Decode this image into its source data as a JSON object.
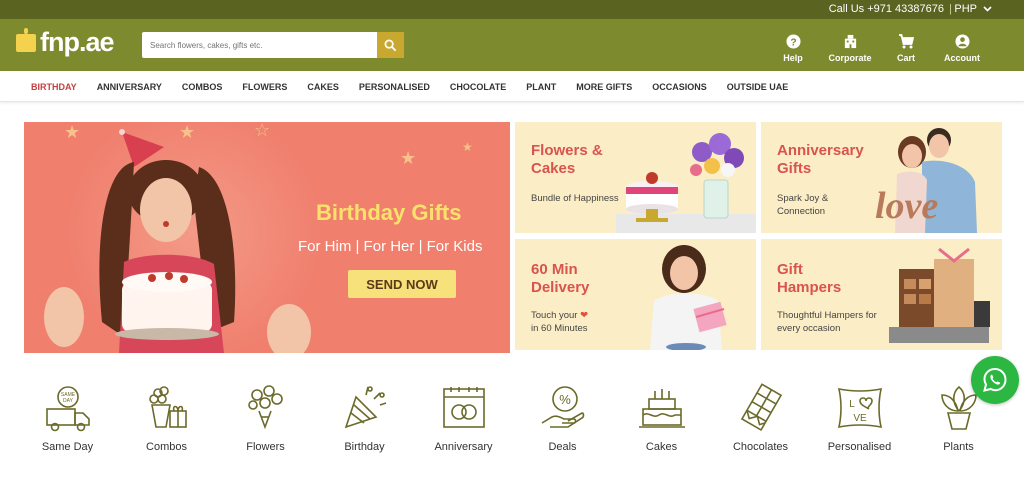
{
  "topbar": {
    "call": "Call Us +971 43387676",
    "separator": "|",
    "currency": "PHP"
  },
  "header": {
    "logo": "fnp.ae",
    "search_placeholder": "Search flowers, cakes, gifts etc.",
    "nav": [
      {
        "label": "Help",
        "icon": "help-icon"
      },
      {
        "label": "Corporate",
        "icon": "corporate-icon"
      },
      {
        "label": "Cart",
        "icon": "cart-icon"
      },
      {
        "label": "Account",
        "icon": "account-icon"
      }
    ]
  },
  "categories_nav": [
    "BIRTHDAY",
    "ANNIVERSARY",
    "COMBOS",
    "FLOWERS",
    "CAKES",
    "PERSONALISED",
    "CHOCOLATE",
    "PLANT",
    "MORE GIFTS",
    "OCCASIONS",
    "OUTSIDE UAE"
  ],
  "hero": {
    "title": "Birthday Gifts",
    "subtitle": "For Him | For Her | For Kids",
    "button": "SEND NOW"
  },
  "tiles": [
    {
      "title": "Flowers & Cakes",
      "subtitle": "Bundle of Happiness"
    },
    {
      "title": "Anniversary Gifts",
      "subtitle": "Spark Joy & Connection"
    },
    {
      "title": "60 Min Delivery",
      "subtitle_part1": "Touch your",
      "subtitle_part2": "in 60 Minutes"
    },
    {
      "title": "Gift Hampers",
      "subtitle": "Thoughtful Hampers for every occasion"
    }
  ],
  "bottom_categories": [
    {
      "label": "Same Day",
      "icon": "same-day-truck-icon"
    },
    {
      "label": "Combos",
      "icon": "combos-icon"
    },
    {
      "label": "Flowers",
      "icon": "flowers-icon"
    },
    {
      "label": "Birthday",
      "icon": "party-popper-icon"
    },
    {
      "label": "Anniversary",
      "icon": "rings-icon"
    },
    {
      "label": "Deals",
      "icon": "deals-icon"
    },
    {
      "label": "Cakes",
      "icon": "cake-icon"
    },
    {
      "label": "Chocolates",
      "icon": "chocolate-icon"
    },
    {
      "label": "Personalised",
      "icon": "love-cushion-icon"
    },
    {
      "label": "Plants",
      "icon": "plant-icon"
    }
  ],
  "colors": {
    "header": "#7d8a2e",
    "topbar": "#5a6420",
    "accent_red": "#d9534f",
    "hero_bg": "#f07f6e",
    "tile_bg": "#fbeec6",
    "whatsapp": "#2cb742"
  }
}
